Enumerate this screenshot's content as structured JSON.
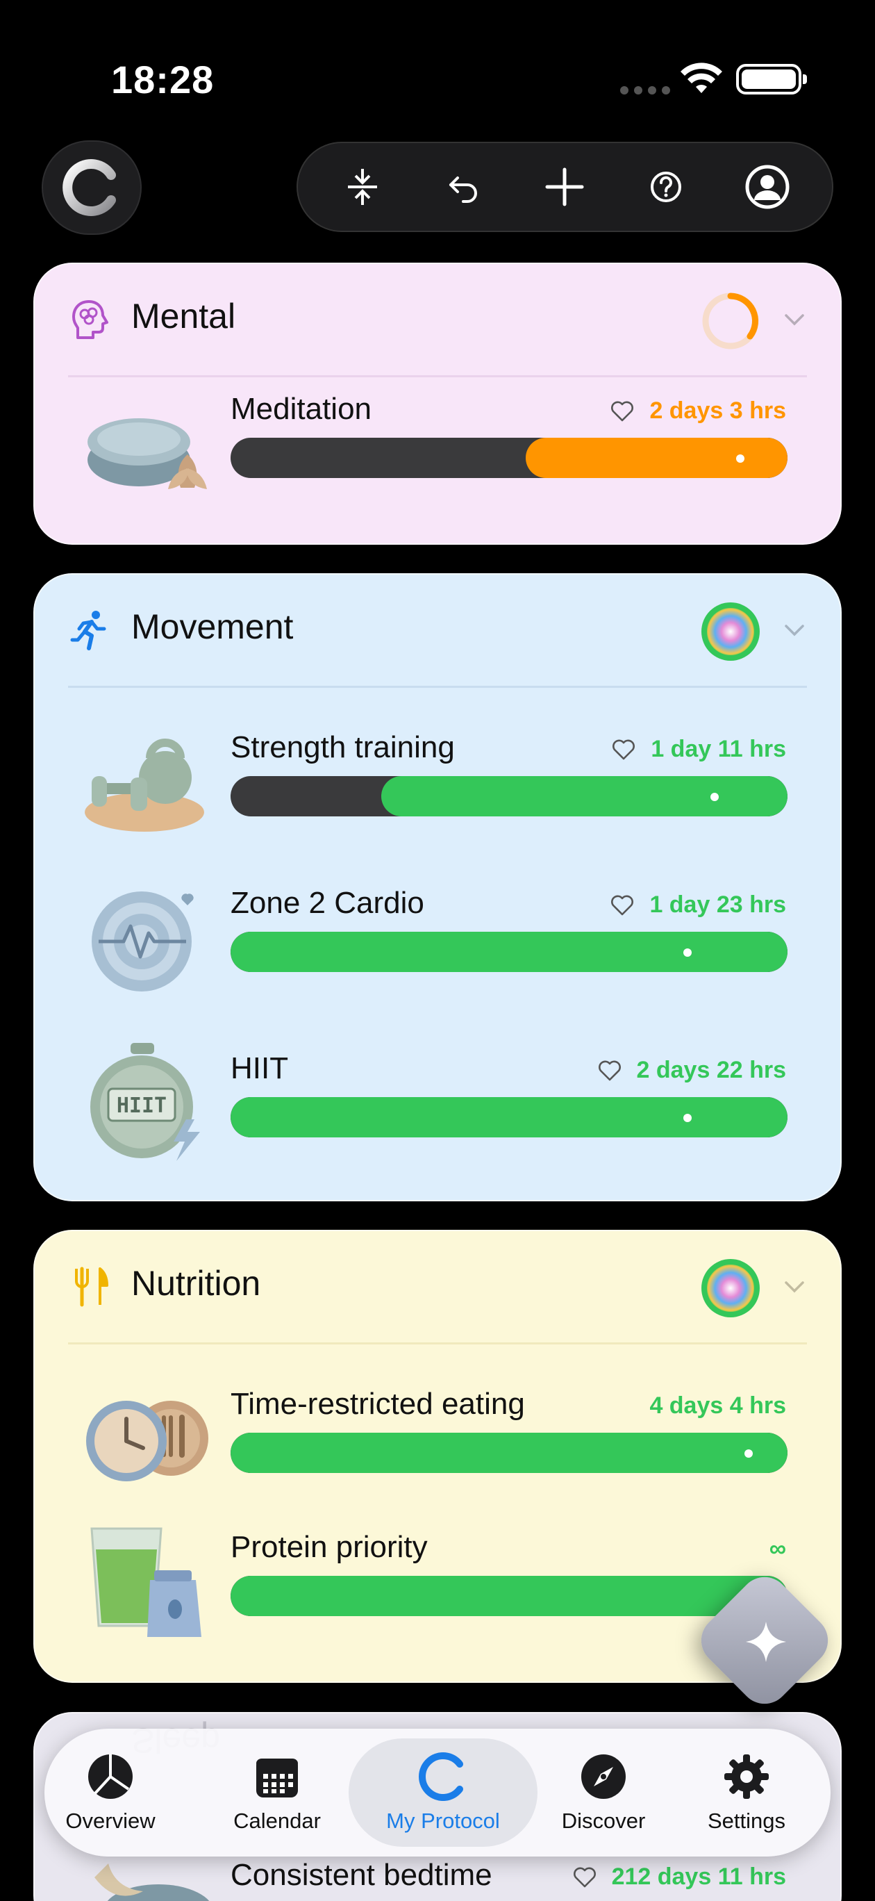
{
  "status_bar": {
    "time": "18:28"
  },
  "toolbar": {
    "buttons": [
      "collapse-icon",
      "undo-icon",
      "plus-icon",
      "help-icon",
      "profile-icon"
    ]
  },
  "colors": {
    "orange": "#ff9500",
    "green": "#34c759",
    "active_blue": "#1a7de8",
    "bar_track": "#3a3a3c"
  },
  "categories": {
    "mental": {
      "title": "Mental",
      "items": [
        {
          "name": "Meditation",
          "time": "2 days 3 hrs",
          "progress": 0.47,
          "color": "orange"
        }
      ]
    },
    "movement": {
      "title": "Movement",
      "items": [
        {
          "name": "Strength training",
          "time": "1 day 11 hrs",
          "progress": 0.73,
          "color": "green"
        },
        {
          "name": "Zone 2 Cardio",
          "time": "1 day 23 hrs",
          "progress": 1.0,
          "color": "green"
        },
        {
          "name": "HIIT",
          "time": "2 days 22 hrs",
          "progress": 1.0,
          "color": "green"
        }
      ]
    },
    "nutrition": {
      "title": "Nutrition",
      "items": [
        {
          "name": "Time-restricted eating",
          "time": "4 days 4 hrs",
          "progress": 1.0,
          "color": "green"
        },
        {
          "name": "Protein priority",
          "time": "∞",
          "progress": 1.0,
          "color": "green"
        }
      ]
    },
    "sleep": {
      "title": "Sleep",
      "items": [
        {
          "name": "Consistent bedtime",
          "time": "212 days 11 hrs"
        }
      ]
    }
  },
  "nav": {
    "overview": "Overview",
    "calendar": "Calendar",
    "my_protocol": "My Protocol",
    "discover": "Discover",
    "settings": "Settings"
  }
}
